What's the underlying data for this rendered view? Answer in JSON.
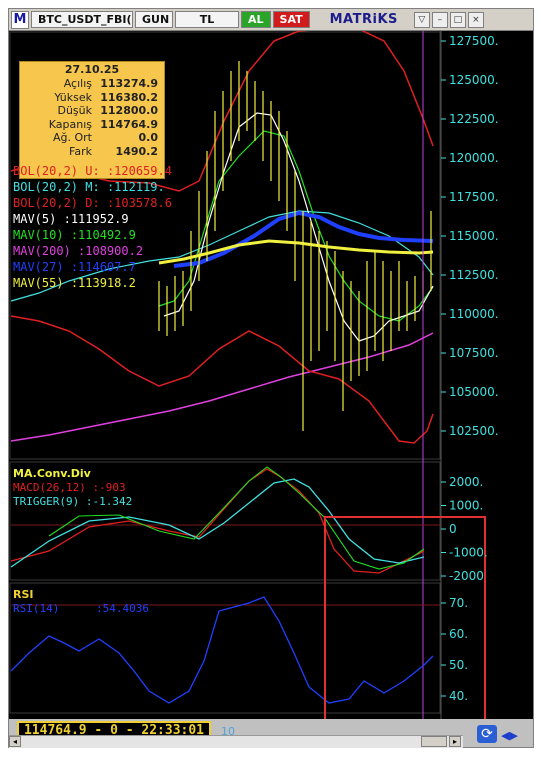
{
  "toolbar": {
    "app_letter": "M",
    "symbol": "BTC_USDT_FBI(",
    "period": "GUN",
    "currency": "TL",
    "buy": "AL",
    "sell": "SAT",
    "brand": "MATRiKS"
  },
  "infobox": {
    "date": "27.10.25",
    "rows": [
      {
        "label": "Açılış",
        "value": "113274.9"
      },
      {
        "label": "Yüksek",
        "value": "116380.2"
      },
      {
        "label": "Düşük",
        "value": "112800.0"
      },
      {
        "label": "Kapanış",
        "value": "114764.9"
      },
      {
        "label": "Ağ. Ort",
        "value": "0.0"
      },
      {
        "label": "Fark",
        "value": "1490.2"
      }
    ]
  },
  "legend": [
    {
      "label": "BOL(20,2) U:",
      "value": ":120659.4",
      "color": "#e02020"
    },
    {
      "label": "BOL(20,2) M:",
      "value": ":112119.",
      "color": "#40e0e0"
    },
    {
      "label": "BOL(20,2) D:",
      "value": ":103578.6",
      "color": "#e02020"
    },
    {
      "label": "MAV(5)",
      "value": ":111952.9",
      "color": "#ffffff"
    },
    {
      "label": "MAV(10)",
      "value": ":110492.9",
      "color": "#20e020"
    },
    {
      "label": "MAV(200)",
      "value": ":108900.2",
      "color": "#e040e0"
    },
    {
      "label": "MAV(27)",
      "value": ":114607.7",
      "color": "#2040ff"
    },
    {
      "label": "MAV(55)",
      "value": ":113918.2",
      "color": "#f0f040"
    }
  ],
  "price_axis": [
    "127500.",
    "125000.",
    "122500.",
    "120000.",
    "117500.",
    "115000.",
    "112500.",
    "110000.",
    "107500.",
    "105000.",
    "102500."
  ],
  "macd": {
    "title": "MA.Conv.Div",
    "macd_label": "MACD(26,12)",
    "macd_value": ":-903",
    "trigger_label": "TRIGGER(9)",
    "trigger_value": ":-1.342",
    "axis": [
      "2000.",
      "1000.",
      "0",
      "-1000.",
      "-2000"
    ]
  },
  "rsi": {
    "title": "RSI",
    "label": "RSI(14)",
    "value": ":54.4036",
    "axis": [
      "70.",
      "60.",
      "50.",
      "40."
    ]
  },
  "status": {
    "readout": "114764.9 - 0 - 22:33:01",
    "count": "10"
  },
  "colors": {
    "background": "#000000",
    "bollinger_outer": "#e02020",
    "bollinger_mid": "#40e0e0",
    "mav5": "#ffffff",
    "mav10": "#20e020",
    "mav200": "#e040e0",
    "mav27": "#2040ff",
    "mav55": "#f0f040",
    "candles": "#f0f040",
    "highlight_box": "#e03030"
  },
  "icons": {
    "refresh": "refresh-icon",
    "scroll_left": "arrow-left-icon",
    "scroll_right": "arrow-right-icon"
  }
}
